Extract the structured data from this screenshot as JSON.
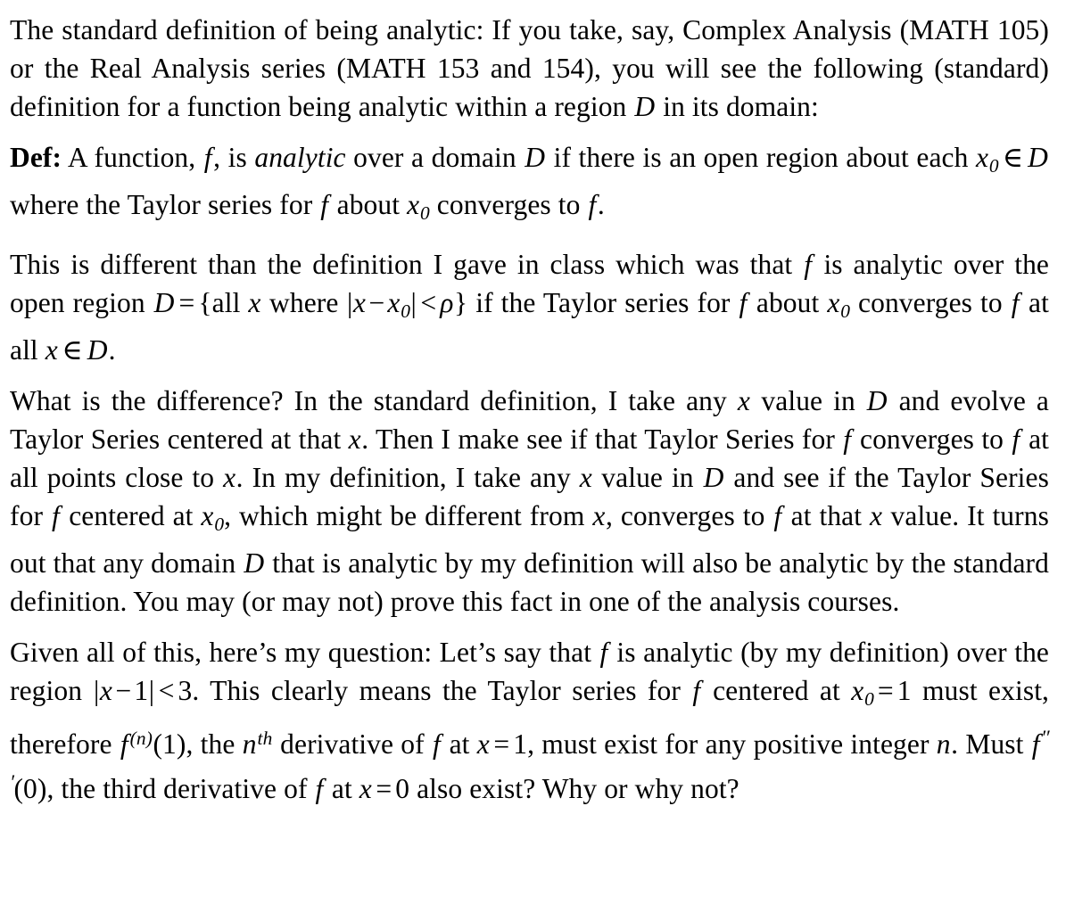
{
  "document": {
    "type": "math-textbook-excerpt",
    "background_color": "#ffffff",
    "text_color": "#000000",
    "paragraphs": [
      {
        "id": "p1",
        "name": "standard-definition-intro",
        "text": "The standard definition of being analytic: If you take, say, Complex Analysis (MATH 105) or the Real Analysis series (MATH 153 and 154), you will see the following (standard) definition for a function being analytic within a region D in its domain:",
        "segments": [
          {
            "t": "The standard definition of being analytic: If you take, say, Complex Analysis (MATH 105) or the Real Analysis series (MATH 153 and 154), you will see the following (standard) definition for a function being analytic within a region ",
            "s": "roman"
          },
          {
            "t": "D",
            "s": "math-italic"
          },
          {
            "t": " in its domain:",
            "s": "roman"
          }
        ]
      },
      {
        "id": "p2",
        "name": "definition-analytic",
        "label": "Def:",
        "text": "Def: A function, f, is analytic over a domain D if there is an open region about each x0 ∈ D where the Taylor series for f about x0 converges to f.",
        "emphasised_word": "analytic"
      },
      {
        "id": "p3",
        "name": "class-definition-contrast",
        "text": "This is different than the definition I gave in class which was that f is analytic over the open region D = {all x where |x − x0| < ρ} if the Taylor series for f about x0 converges to f at all x ∈ D.",
        "set_notation": "D = {all x where |x − x₀| < ρ}"
      },
      {
        "id": "p4",
        "name": "difference-explanation",
        "text": "What is the difference? In the standard definition, I take any x value in D and evolve a Taylor Series centered at that x. Then I make see if that Taylor Series for f converges to f at all points close to x. In my definition, I take any x value in D and see if the Taylor Series for f centered at x0, which might be different from x, converges to f at that x value. It turns out that any domain D that is analytic by my definition will also be analytic by the standard definition. You may (or may not) prove this fact in one of the analysis courses."
      },
      {
        "id": "p5",
        "name": "question-paragraph",
        "text": "Given all of this, here’s my question: Let’s say that f is analytic (by my definition) over the region |x − 1| < 3. This clearly means the Taylor series for f centered at x0 = 1 must exist, therefore f(n)(1), the nth derivative of f at x = 1, must exist for any positive integer n. Must f′′′(0), the third derivative of f at x = 0 also exist? Why or why not?",
        "region": "|x − 1| < 3",
        "center": "x₀ = 1",
        "derivative_general": "f⁽ⁿ⁾(1)",
        "derivative_third": "f‴(0)",
        "evaluation_point": "x = 0"
      }
    ],
    "tokens": {
      "p1": {
        "a": "The standard definition of being analytic: If you take, say, Complex Analysis (MATH 105) or the Real Analysis series (MATH 153 and 154), you will see the following (standard) definition for a function being analytic within a region",
        "var_D": "D",
        "b": "in its domain:"
      },
      "p2": {
        "def_label": "Def:",
        "a": "A function,",
        "var_f1": "f",
        "b": ", is",
        "emph": "analytic",
        "c": "over a domain",
        "var_D1": "D",
        "d": "if there is an open region about each",
        "var_x1": "x",
        "sub0a": "0",
        "in1": "∈",
        "var_D2": "D",
        "e": "where the Taylor series for",
        "var_f2": "f",
        "g": "about",
        "var_x2": "x",
        "sub0b": "0",
        "h": "converges to",
        "var_f3": "f",
        "i": "."
      },
      "p3": {
        "a": "This is different than the definition I gave in class which was that",
        "var_f1": "f",
        "b": "is analytic over the open region",
        "var_D1": "D",
        "eq": "=",
        "lbrace": "{",
        "c": "all",
        "var_x1": "x",
        "d": "where",
        "bar1": "|",
        "var_x2": "x",
        "minus": "−",
        "var_x3": "x",
        "sub0a": "0",
        "bar2": "|",
        "lt": "<",
        "rho": "ρ",
        "rbrace": "}",
        "e": "if the Taylor series for",
        "var_f2": "f",
        "g": "about",
        "var_x4": "x",
        "sub0b": "0",
        "h": "converges to",
        "var_f3": "f",
        "i": "at all",
        "var_x5": "x",
        "in1": "∈",
        "var_D2": "D",
        "j": "."
      },
      "p4": {
        "a": "What is the difference?  In the standard definition, I take any",
        "var_x1": "x",
        "b": "value in",
        "var_D1": "D",
        "c": "and evolve a Taylor Series centered at that",
        "var_x2": "x",
        "d": ".  Then I make see if that Taylor Series for",
        "var_f1": "f",
        "e": "converges to",
        "var_f2": "f",
        "g": "at all points close to",
        "var_x3": "x",
        "h": ". In my definition, I take any",
        "var_x4": "x",
        "i": "value in",
        "var_D2": "D",
        "j": "and see if the Taylor Series for",
        "var_f3": "f",
        "k": "centered at",
        "var_x5": "x",
        "sub0a": "0",
        "l": ", which might be different from",
        "var_x6": "x",
        "m": ", converges to",
        "var_f4": "f",
        "n": "at that",
        "var_x7": "x",
        "o": "value.  It turns out that any domain",
        "var_D3": "D",
        "p": "that is analytic by my definition will also be analytic by the standard definition. You may (or may not) prove this fact in one of the analysis courses."
      },
      "p5": {
        "a": "Given all of this, here’s my question:  Let’s say that",
        "var_f1": "f",
        "b": "is analytic (by my definition) over the region",
        "bar1": "|",
        "var_x1": "x",
        "minus1": "−",
        "one1": "1",
        "bar2": "|",
        "lt1": "<",
        "three": "3",
        "c": ". This clearly means the Taylor series for",
        "var_f2": "f",
        "d": "centered at",
        "var_x2": "x",
        "sub0a": "0",
        "eq1": "=",
        "one2": "1",
        "e": "must exist, therefore",
        "var_f3": "f",
        "supn": "(n)",
        "paren1": "(1)",
        "g": ", the",
        "var_n1": "n",
        "supth": "th",
        "h": "derivative of",
        "var_f4": "f",
        "i": "at",
        "var_x3": "x",
        "eq2": "=",
        "one3": "1",
        "j": ", must exist for any positive integer",
        "var_n2": "n",
        "k": ".  Must",
        "var_f5": "f",
        "primes": "′′′",
        "paren2": "(0)",
        "l": ", the third derivative of",
        "var_f6": "f",
        "m": "at",
        "var_x4": "x",
        "eq3": "=",
        "zero": "0",
        "n": "also exist? Why or why not?"
      }
    }
  }
}
